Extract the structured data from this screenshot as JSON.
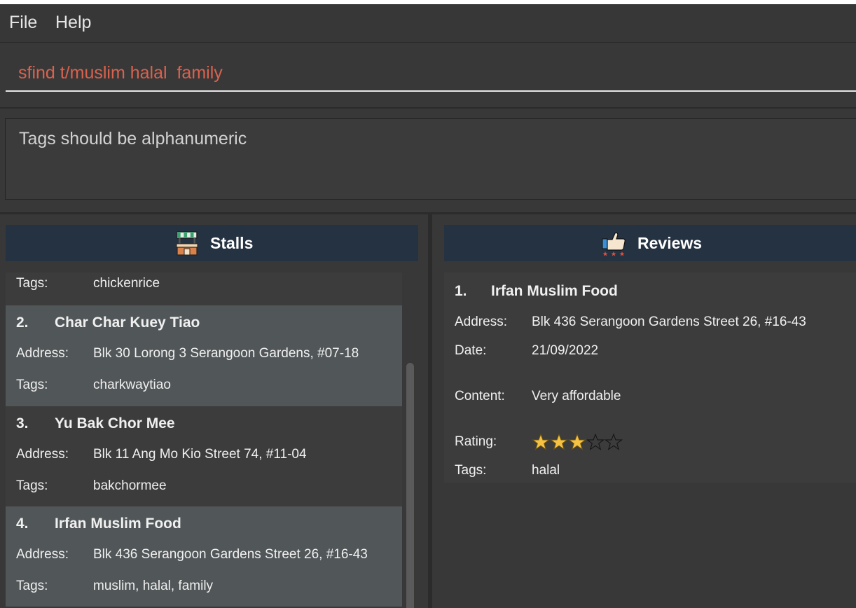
{
  "menu": {
    "file": "File",
    "help": "Help"
  },
  "command": {
    "value": "sfind t/muslim halal  family"
  },
  "result": {
    "message": "Tags should be alphanumeric"
  },
  "stalls": {
    "title": "Stalls",
    "partial_tags_label": "Tags:",
    "partial_tags_value": "chickenrice",
    "items": [
      {
        "index": "2.",
        "name": "Char Char Kuey Tiao",
        "address_label": "Address:",
        "address": "Blk 30 Lorong 3 Serangoon Gardens, #07-18",
        "tags_label": "Tags:",
        "tags": "charkwaytiao"
      },
      {
        "index": "3.",
        "name": "Yu Bak Chor Mee",
        "address_label": "Address:",
        "address": "Blk 11 Ang Mo Kio Street 74, #11-04",
        "tags_label": "Tags:",
        "tags": "bakchormee"
      },
      {
        "index": "4.",
        "name": "Irfan Muslim Food",
        "address_label": "Address:",
        "address": "Blk 436 Serangoon Gardens Street 26, #16-43",
        "tags_label": "Tags:",
        "tags": "muslim, halal, family"
      }
    ]
  },
  "reviews": {
    "title": "Reviews",
    "items": [
      {
        "index": "1.",
        "name": "Irfan Muslim Food",
        "address_label": "Address:",
        "address": "Blk 436 Serangoon Gardens Street 26, #16-43",
        "date_label": "Date:",
        "date": "21/09/2022",
        "content_label": "Content:",
        "content": "Very affordable",
        "rating_label": "Rating:",
        "rating": 3,
        "rating_max": 5,
        "tags_label": "Tags:",
        "tags": "halal"
      }
    ]
  },
  "colors": {
    "header_bg": "#253242",
    "command_text": "#d9624e",
    "star_filled": "#f6c244",
    "card_alt": "#515658"
  },
  "icons": {
    "stalls": "market-stall-icon",
    "reviews": "thumbs-up-rating-icon"
  }
}
